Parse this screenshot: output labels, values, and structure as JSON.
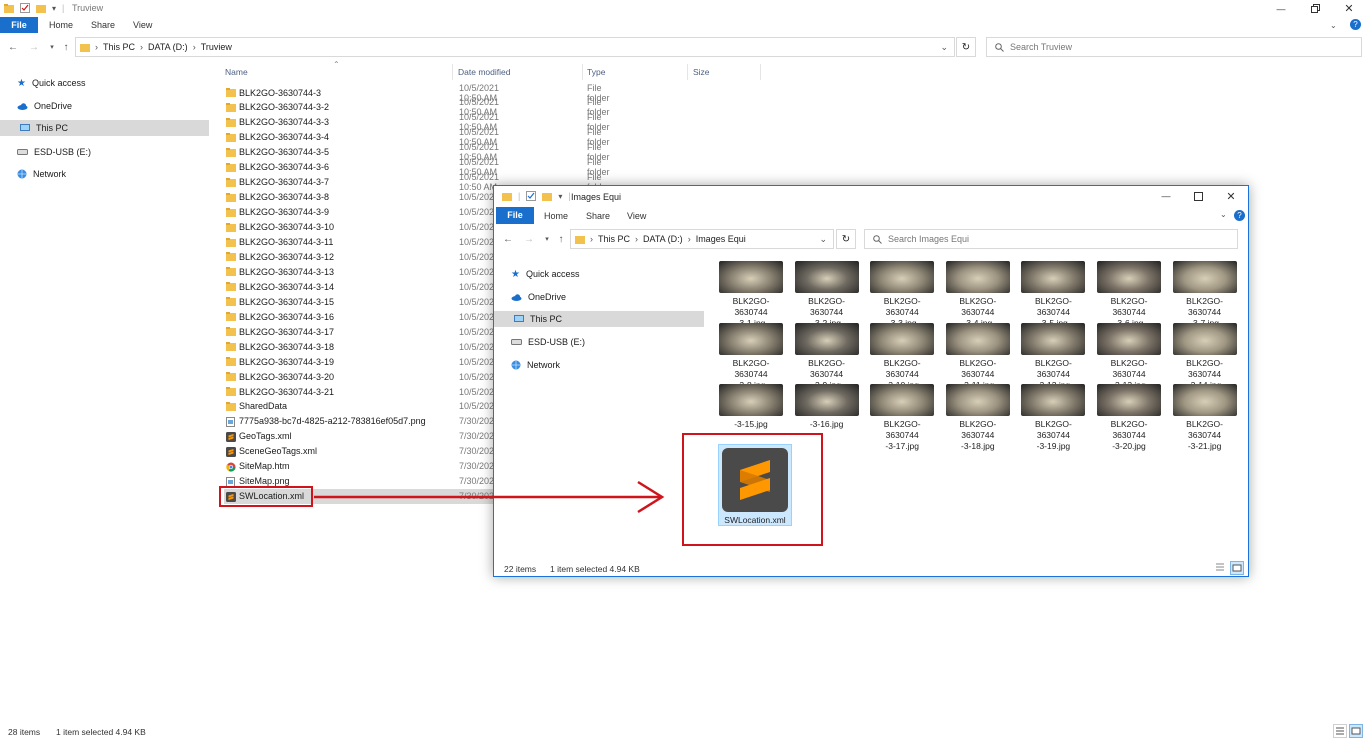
{
  "main_window": {
    "title": "Truview",
    "ribbon_tabs": {
      "file": "File",
      "home": "Home",
      "share": "Share",
      "view": "View"
    },
    "address": {
      "this_pc": "This PC",
      "drive": "DATA (D:)",
      "folder": "Truview"
    },
    "search_placeholder": "Search Truview",
    "nav": {
      "quick_access": "Quick access",
      "onedrive": "OneDrive",
      "this_pc": "This PC",
      "usb": "ESD-USB (E:)",
      "network": "Network"
    },
    "columns": {
      "name": "Name",
      "date": "Date modified",
      "type": "Type",
      "size": "Size"
    },
    "files": [
      {
        "name": "BLK2GO-3630744-3",
        "date": "10/5/2021 10:50 AM",
        "type": "File folder",
        "icon": "folder-icon"
      },
      {
        "name": "BLK2GO-3630744-3-2",
        "date": "10/5/2021 10:50 AM",
        "type": "File folder",
        "icon": "folder-icon"
      },
      {
        "name": "BLK2GO-3630744-3-3",
        "date": "10/5/2021 10:50 AM",
        "type": "File folder",
        "icon": "folder-icon"
      },
      {
        "name": "BLK2GO-3630744-3-4",
        "date": "10/5/2021 10:50 AM",
        "type": "File folder",
        "icon": "folder-icon"
      },
      {
        "name": "BLK2GO-3630744-3-5",
        "date": "10/5/2021 10:50 AM",
        "type": "File folder",
        "icon": "folder-icon"
      },
      {
        "name": "BLK2GO-3630744-3-6",
        "date": "10/5/2021 10:50 AM",
        "type": "File folder",
        "icon": "folder-icon"
      },
      {
        "name": "BLK2GO-3630744-3-7",
        "date": "10/5/2021 10:50 AM",
        "type": "File folder",
        "icon": "folder-icon"
      },
      {
        "name": "BLK2GO-3630744-3-8",
        "date": "10/5/2021",
        "type": "",
        "icon": "folder-icon"
      },
      {
        "name": "BLK2GO-3630744-3-9",
        "date": "10/5/2021",
        "type": "",
        "icon": "folder-icon"
      },
      {
        "name": "BLK2GO-3630744-3-10",
        "date": "10/5/2021",
        "type": "",
        "icon": "folder-icon"
      },
      {
        "name": "BLK2GO-3630744-3-11",
        "date": "10/5/2021",
        "type": "",
        "icon": "folder-icon"
      },
      {
        "name": "BLK2GO-3630744-3-12",
        "date": "10/5/2021",
        "type": "",
        "icon": "folder-icon"
      },
      {
        "name": "BLK2GO-3630744-3-13",
        "date": "10/5/2021",
        "type": "",
        "icon": "folder-icon"
      },
      {
        "name": "BLK2GO-3630744-3-14",
        "date": "10/5/2021",
        "type": "",
        "icon": "folder-icon"
      },
      {
        "name": "BLK2GO-3630744-3-15",
        "date": "10/5/2021",
        "type": "",
        "icon": "folder-icon"
      },
      {
        "name": "BLK2GO-3630744-3-16",
        "date": "10/5/2021",
        "type": "",
        "icon": "folder-icon"
      },
      {
        "name": "BLK2GO-3630744-3-17",
        "date": "10/5/2021",
        "type": "",
        "icon": "folder-icon"
      },
      {
        "name": "BLK2GO-3630744-3-18",
        "date": "10/5/2021",
        "type": "",
        "icon": "folder-icon"
      },
      {
        "name": "BLK2GO-3630744-3-19",
        "date": "10/5/2021",
        "type": "",
        "icon": "folder-icon"
      },
      {
        "name": "BLK2GO-3630744-3-20",
        "date": "10/5/2021",
        "type": "",
        "icon": "folder-icon"
      },
      {
        "name": "BLK2GO-3630744-3-21",
        "date": "10/5/2021",
        "type": "",
        "icon": "folder-icon"
      },
      {
        "name": "SharedData",
        "date": "10/5/2021",
        "type": "",
        "icon": "folder-icon"
      },
      {
        "name": "7775a938-bc7d-4825-a212-783816ef05d7.png",
        "date": "7/30/2021",
        "type": "",
        "icon": "image-file-icon"
      },
      {
        "name": "GeoTags.xml",
        "date": "7/30/2021",
        "type": "",
        "icon": "sublime-file-icon"
      },
      {
        "name": "SceneGeoTags.xml",
        "date": "7/30/2021",
        "type": "",
        "icon": "sublime-file-icon"
      },
      {
        "name": "SiteMap.htm",
        "date": "7/30/2021",
        "type": "",
        "icon": "chrome-file-icon"
      },
      {
        "name": "SiteMap.png",
        "date": "7/30/2021",
        "type": "",
        "icon": "image-file-icon"
      },
      {
        "name": "SWLocation.xml",
        "date": "7/30/2021",
        "type": "",
        "icon": "sublime-file-icon",
        "selected": true
      }
    ],
    "status": {
      "items": "28 items",
      "selected": "1 item selected  4.94 KB"
    }
  },
  "sub_window": {
    "title": "Images Equi",
    "ribbon_tabs": {
      "file": "File",
      "home": "Home",
      "share": "Share",
      "view": "View"
    },
    "address": {
      "this_pc": "This PC",
      "drive": "DATA (D:)",
      "folder": "Images Equi"
    },
    "search_placeholder": "Search Images Equi",
    "nav": {
      "quick_access": "Quick access",
      "onedrive": "OneDrive",
      "this_pc": "This PC",
      "usb": "ESD-USB (E:)",
      "network": "Network"
    },
    "thumbnails": [
      {
        "line1": "BLK2GO-3630744",
        "line2": "-3-1.jpg"
      },
      {
        "line1": "BLK2GO-3630744",
        "line2": "-3-2.jpg"
      },
      {
        "line1": "BLK2GO-3630744",
        "line2": "-3-3.jpg"
      },
      {
        "line1": "BLK2GO-3630744",
        "line2": "-3-4.jpg"
      },
      {
        "line1": "BLK2GO-3630744",
        "line2": "-3-5.jpg"
      },
      {
        "line1": "BLK2GO-3630744",
        "line2": "-3-6.jpg"
      },
      {
        "line1": "BLK2GO-3630744",
        "line2": "-3-7.jpg"
      },
      {
        "line1": "BLK2GO-3630744",
        "line2": "-3-8.jpg"
      },
      {
        "line1": "BLK2GO-3630744",
        "line2": "-3-9.jpg"
      },
      {
        "line1": "BLK2GO-3630744",
        "line2": "-3-10.jpg"
      },
      {
        "line1": "BLK2GO-3630744",
        "line2": "-3-11.jpg"
      },
      {
        "line1": "BLK2GO-3630744",
        "line2": "-3-12.jpg"
      },
      {
        "line1": "BLK2GO-3630744",
        "line2": "-3-13.jpg"
      },
      {
        "line1": "BLK2GO-3630744",
        "line2": "-3-14.jpg"
      },
      {
        "line1": "",
        "line2": "-3-15.jpg"
      },
      {
        "line1": "",
        "line2": "-3-16.jpg"
      },
      {
        "line1": "BLK2GO-3630744",
        "line2": "-3-17.jpg"
      },
      {
        "line1": "BLK2GO-3630744",
        "line2": "-3-18.jpg"
      },
      {
        "line1": "BLK2GO-3630744",
        "line2": "-3-19.jpg"
      },
      {
        "line1": "BLK2GO-3630744",
        "line2": "-3-20.jpg"
      },
      {
        "line1": "BLK2GO-3630744",
        "line2": "-3-21.jpg"
      }
    ],
    "selected_file": "SWLocation.xml",
    "status": {
      "items": "22 items",
      "selected": "1 item selected  4.94 KB"
    }
  },
  "colors": {
    "accent": "#1a6fcc",
    "folder": "#f2c14e",
    "highlight_red": "#d0141c",
    "selection": "#cce8ff",
    "nav_selected": "#d9d9d9",
    "sublime_orange": "#ff9800"
  }
}
